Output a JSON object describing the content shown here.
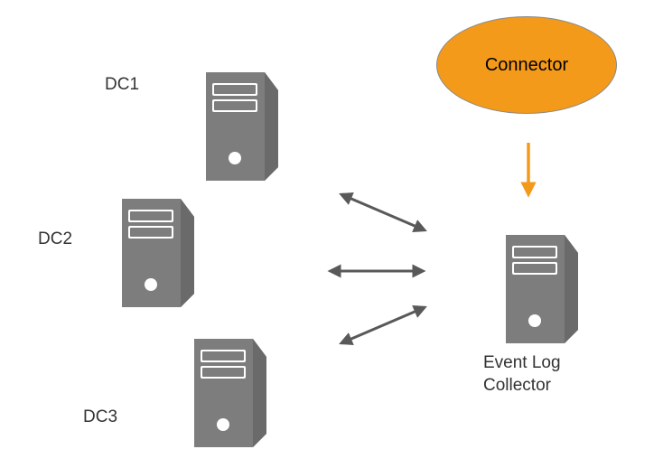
{
  "nodes": {
    "dc1": {
      "label": "DC1"
    },
    "dc2": {
      "label": "DC2"
    },
    "dc3": {
      "label": "DC3"
    },
    "collector": {
      "label_line1": "Event Log",
      "label_line2": "Collector"
    },
    "connector": {
      "label": "Connector"
    }
  },
  "colors": {
    "server": "#7d7d7d",
    "accent": "#f49a1b",
    "arrow": "#595959"
  },
  "chart_data": {
    "type": "diagram",
    "title": "",
    "nodes": [
      {
        "id": "dc1",
        "label": "DC1",
        "kind": "server"
      },
      {
        "id": "dc2",
        "label": "DC2",
        "kind": "server"
      },
      {
        "id": "dc3",
        "label": "DC3",
        "kind": "server"
      },
      {
        "id": "collector",
        "label": "Event Log Collector",
        "kind": "server"
      },
      {
        "id": "connector",
        "label": "Connector",
        "kind": "ellipse",
        "color": "#f49a1b"
      }
    ],
    "edges": [
      {
        "from": "dc1",
        "to": "collector",
        "direction": "bidirectional"
      },
      {
        "from": "dc2",
        "to": "collector",
        "direction": "bidirectional"
      },
      {
        "from": "dc3",
        "to": "collector",
        "direction": "bidirectional"
      },
      {
        "from": "connector",
        "to": "collector",
        "direction": "unidirectional",
        "color": "#f49a1b"
      }
    ]
  }
}
